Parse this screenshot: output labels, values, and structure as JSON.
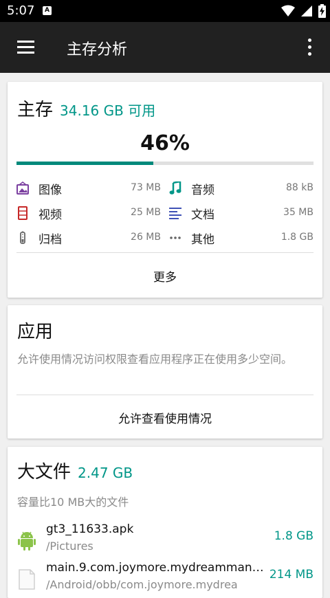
{
  "status_bar": {
    "time": "5:07",
    "badge": "A"
  },
  "app_bar": {
    "title": "主存分析"
  },
  "storage_card": {
    "title": "主存",
    "available": "34.16 GB 可用",
    "percent_text": "46%",
    "used_fraction": 0.46,
    "categories": [
      {
        "label": "图像",
        "size": "73 MB",
        "icon": "image-icon",
        "color": "#7b3fa0"
      },
      {
        "label": "音频",
        "size": "88 kB",
        "icon": "music-note-icon",
        "color": "#009688"
      },
      {
        "label": "视频",
        "size": "25 MB",
        "icon": "video-icon",
        "color": "#c62828"
      },
      {
        "label": "文档",
        "size": "35 MB",
        "icon": "document-icon",
        "color": "#3f51b5"
      },
      {
        "label": "归档",
        "size": "26 MB",
        "icon": "archive-icon",
        "color": "#666666"
      },
      {
        "label": "其他",
        "size": "1.8 GB",
        "icon": "more-horiz-icon",
        "color": "#666666"
      }
    ],
    "more_label": "更多"
  },
  "apps_card": {
    "title": "应用",
    "description": "允许使用情况访问权限查看应用程序正在使用多少空间。",
    "button_label": "允许查看使用情况"
  },
  "large_files_card": {
    "title": "大文件",
    "total": "2.47 GB",
    "description": "容量比10 MB大的文件",
    "files": [
      {
        "name": "gt3_11633.apk",
        "path": "/Pictures",
        "size": "1.8 GB",
        "icon": "android-icon"
      },
      {
        "name": "main.9.com.joymore.mydreammans…",
        "path": "/Android/obb/com.joymore.mydrea",
        "size": "214 MB",
        "icon": "file-icon"
      }
    ]
  },
  "colors": {
    "accent": "#009688",
    "appbar": "#212121"
  }
}
